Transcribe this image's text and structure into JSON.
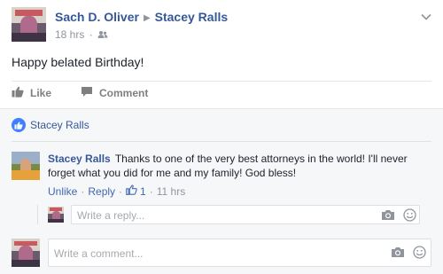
{
  "post": {
    "author": "Sach D. Oliver",
    "target": "Stacey Ralls",
    "time": "18 hrs",
    "audience_icon": "friends-icon",
    "menu_icon": "chevron-down-icon",
    "text": "Happy belated Birthday!"
  },
  "actions": {
    "like_label": "Like",
    "comment_label": "Comment"
  },
  "likes": {
    "names": "Stacey Ralls"
  },
  "comment": {
    "author": "Stacey Ralls",
    "text": "Thanks to one of the very best attorneys in the world! I'll never forget what you did for me and my family! God bless!",
    "unlike_label": "Unlike",
    "reply_label": "Reply",
    "like_count": "1",
    "time": "11 hrs"
  },
  "reply_input": {
    "placeholder": "Write a reply..."
  },
  "comment_input": {
    "placeholder": "Write a comment..."
  },
  "colors": {
    "link": "#365899",
    "muted": "#90949c",
    "like_blue": "#4080ff",
    "background_comments": "#f6f7f9"
  }
}
